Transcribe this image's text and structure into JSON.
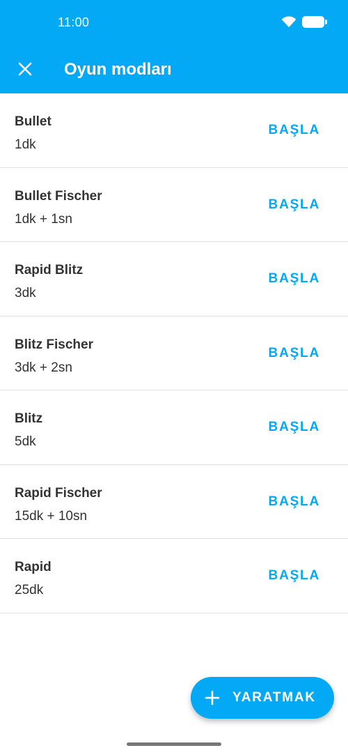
{
  "status_bar": {
    "time": "11:00",
    "wifi_icon": "wifi-icon",
    "battery_icon": "battery-icon"
  },
  "header": {
    "title": "Oyun modları",
    "close_icon": "close-icon"
  },
  "modes": [
    {
      "name": "Bullet",
      "time": "1dk",
      "action": "BAŞLA"
    },
    {
      "name": "Bullet Fischer",
      "time": "1dk + 1sn",
      "action": "BAŞLA"
    },
    {
      "name": "Rapid Blitz",
      "time": "3dk",
      "action": "BAŞLA"
    },
    {
      "name": "Blitz Fischer",
      "time": "3dk + 2sn",
      "action": "BAŞLA"
    },
    {
      "name": "Blitz",
      "time": "5dk",
      "action": "BAŞLA"
    },
    {
      "name": "Rapid Fischer",
      "time": "15dk + 10sn",
      "action": "BAŞLA"
    },
    {
      "name": "Rapid",
      "time": "25dk",
      "action": "BAŞLA"
    }
  ],
  "fab": {
    "label": "YARATMAK",
    "icon": "plus-icon"
  },
  "colors": {
    "accent": "#03A9F4",
    "text": "#333333",
    "divider": "#e0e0e0"
  }
}
